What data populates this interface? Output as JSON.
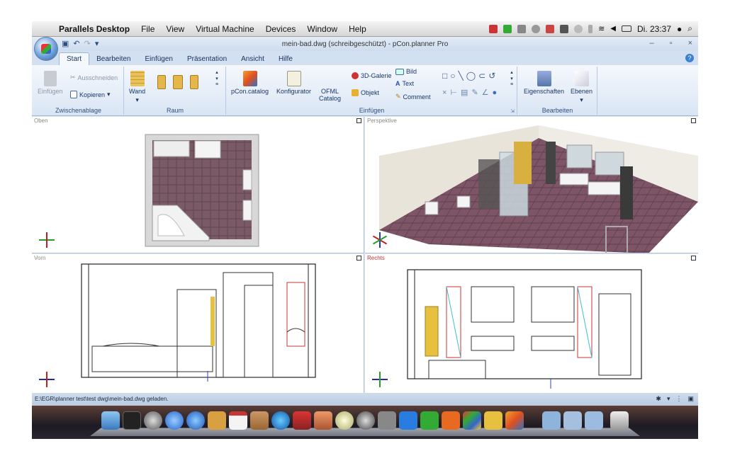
{
  "menubar": {
    "app": "Parallels Desktop",
    "items": [
      "File",
      "View",
      "Virtual Machine",
      "Devices",
      "Window",
      "Help"
    ],
    "clock": "Di. 23:37"
  },
  "window": {
    "title": "mein-bad.dwg (schreibgeschützt) - pCon.planner Pro",
    "controls": [
      "–",
      "▫",
      "×"
    ]
  },
  "tabs": [
    "Start",
    "Bearbeiten",
    "Einfügen",
    "Präsentation",
    "Ansicht",
    "Hilfe"
  ],
  "ribbon": {
    "zwischenablage": {
      "label": "Zwischenablage",
      "einfuegen": "Einfügen",
      "ausschneiden": "Ausschneiden",
      "kopieren": "Kopieren"
    },
    "raum": {
      "label": "Raum",
      "wand": "Wand"
    },
    "einfuegen": {
      "label": "Einfügen",
      "pcon_catalog": "pCon.catalog",
      "konfigurator": "Konfigurator",
      "ofml": "OFML",
      "catalog": "Catalog",
      "galerie": "3D-Galerie",
      "objekt": "Objekt",
      "bild": "Bild",
      "text": "Text",
      "comment": "Comment"
    },
    "bearbeiten": {
      "label": "Bearbeiten",
      "eigenschaften": "Eigenschaften",
      "ebenen": "Ebenen"
    }
  },
  "viewports": {
    "oben": "Oben",
    "perspektive": "Perspektive",
    "vorn": "Vorn",
    "rechts": "Rechts"
  },
  "status": {
    "message": "E:\\EGR\\planner test\\test dwg\\mein-bad.dwg geladen."
  }
}
